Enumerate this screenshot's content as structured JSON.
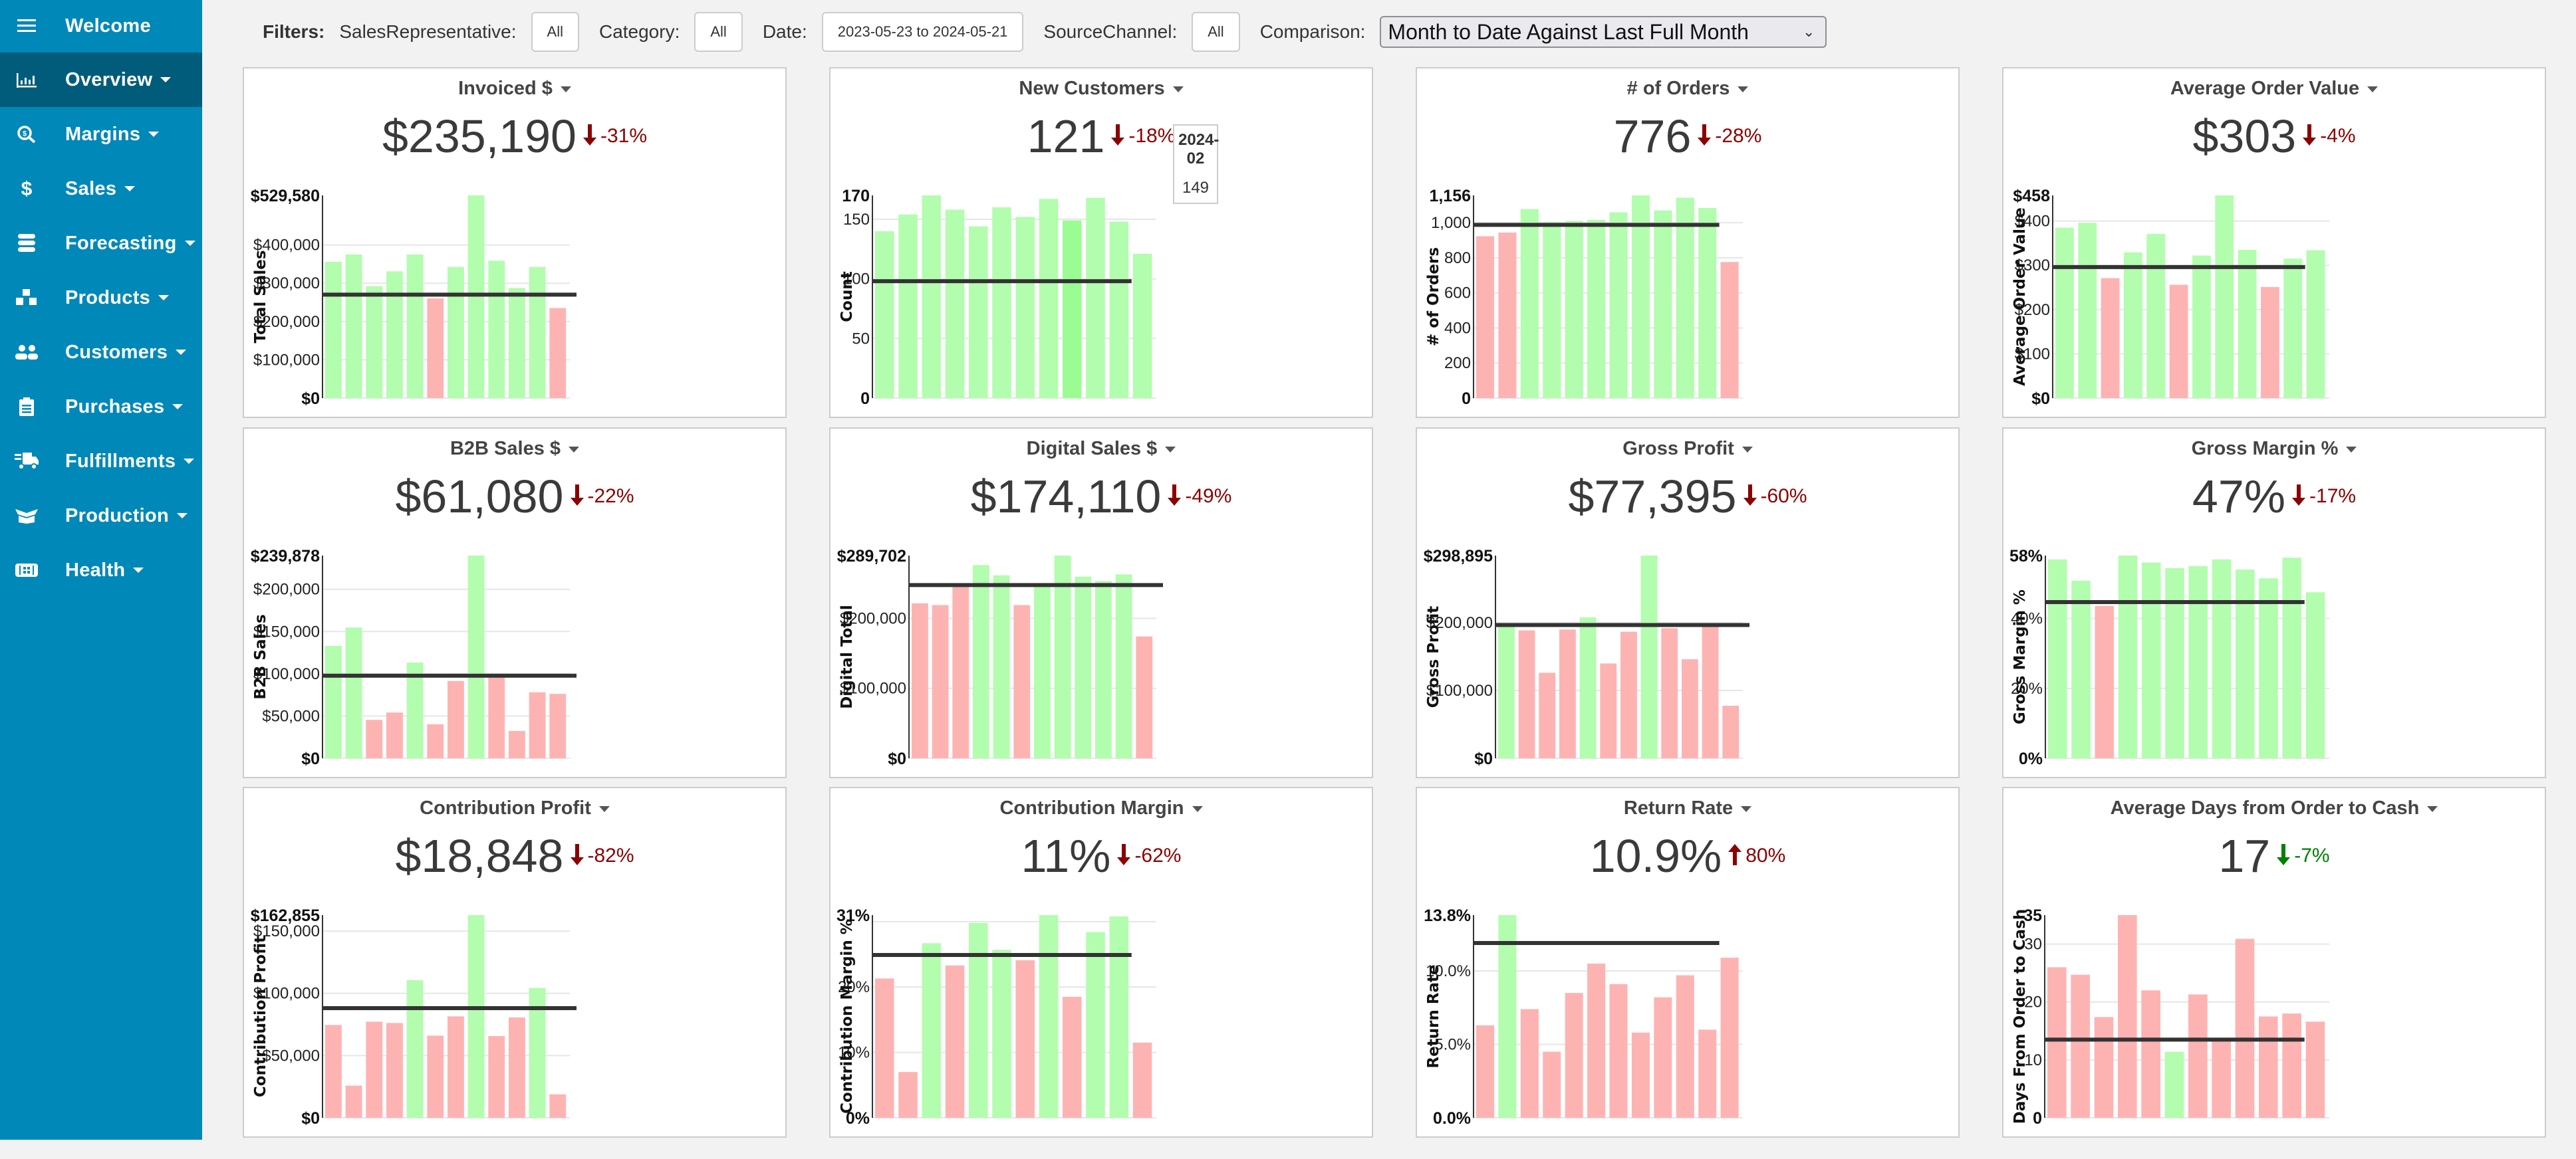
{
  "sidebar": {
    "items": [
      {
        "label": "Welcome",
        "icon": "menu-icon",
        "caret": false,
        "active": false
      },
      {
        "label": "Overview",
        "icon": "bar-chart-icon",
        "caret": true,
        "active": true
      },
      {
        "label": "Margins",
        "icon": "search-dollar-icon",
        "caret": true,
        "active": false
      },
      {
        "label": "Sales",
        "icon": "dollar-icon",
        "caret": true,
        "active": false
      },
      {
        "label": "Forecasting",
        "icon": "database-icon",
        "caret": true,
        "active": false
      },
      {
        "label": "Products",
        "icon": "boxes-icon",
        "caret": true,
        "active": false
      },
      {
        "label": "Customers",
        "icon": "users-icon",
        "caret": true,
        "active": false
      },
      {
        "label": "Purchases",
        "icon": "clipboard-icon",
        "caret": true,
        "active": false
      },
      {
        "label": "Fulfillments",
        "icon": "truck-icon",
        "caret": true,
        "active": false
      },
      {
        "label": "Production",
        "icon": "box-open-icon",
        "caret": true,
        "active": false
      },
      {
        "label": "Health",
        "icon": "health-icon",
        "caret": true,
        "active": false
      }
    ]
  },
  "filters": {
    "title": "Filters:",
    "sales_rep_label": "SalesRepresentative:",
    "sales_rep_value": "All",
    "category_label": "Category:",
    "category_value": "All",
    "date_label": "Date:",
    "date_value": "2023-05-23 to 2024-05-21",
    "source_label": "SourceChannel:",
    "source_value": "All",
    "comparison_label": "Comparison:",
    "comparison_value": "Month to Date Against Last Full Month"
  },
  "colors": {
    "sidebar_bg": "#0088b8",
    "sidebar_active": "#005c7a",
    "bar_good": "#b3fdae",
    "bar_bad": "#feb3b3",
    "bar_hover": "#9cfc94",
    "target_line": "#333333",
    "change_bad": "#8b0000",
    "change_good": "#008000"
  },
  "tooltip": {
    "card": 1,
    "bar_index": 8,
    "title": "2024-02",
    "value": "149"
  },
  "chart_data": [
    {
      "type": "bar",
      "title": "Invoiced $",
      "kpi": "$235,190",
      "change": "-31%",
      "direction": "down",
      "change_status": "bad",
      "ylabel": "Total Sales",
      "ylim": [
        0,
        529580
      ],
      "ymax_label": "$529,580",
      "ticks": [
        {
          "v": 100000,
          "l": "$100,000"
        },
        {
          "v": 200000,
          "l": "$200,000"
        },
        {
          "v": 300000,
          "l": "$300,000"
        },
        {
          "v": 400000,
          "l": "$400,000"
        }
      ],
      "zero_label": "$0",
      "values": [
        355950,
        375050,
        292290,
        331060,
        375050,
        260450,
        342630,
        529580,
        358840,
        287650,
        342630,
        235190
      ],
      "status": [
        "g",
        "g",
        "g",
        "g",
        "g",
        "r",
        "g",
        "g",
        "g",
        "g",
        "g",
        "r"
      ],
      "target": 270290,
      "target_full": true
    },
    {
      "type": "bar",
      "title": "New Customers",
      "kpi": "121",
      "change": "-18%",
      "direction": "down",
      "change_status": "bad",
      "ylabel": "Count",
      "ylim": [
        0,
        170
      ],
      "ymax_label": "170",
      "ticks": [
        {
          "v": 50,
          "l": "50"
        },
        {
          "v": 100,
          "l": "100"
        },
        {
          "v": 150,
          "l": "150"
        }
      ],
      "zero_label": "0",
      "values": [
        140,
        154,
        170,
        158,
        144,
        160,
        152,
        167,
        149,
        168,
        148,
        121
      ],
      "status": [
        "g",
        "g",
        "g",
        "g",
        "g",
        "g",
        "g",
        "g",
        "h",
        "g",
        "g",
        "g"
      ],
      "target": 98,
      "target_full": false
    },
    {
      "type": "bar",
      "title": "# of Orders",
      "kpi": "776",
      "change": "-28%",
      "direction": "down",
      "change_status": "bad",
      "ylabel": "# of Orders",
      "ylim": [
        0,
        1156
      ],
      "ymax_label": "1,156",
      "ticks": [
        {
          "v": 200,
          "l": "200"
        },
        {
          "v": 400,
          "l": "400"
        },
        {
          "v": 600,
          "l": "600"
        },
        {
          "v": 800,
          "l": "800"
        },
        {
          "v": 1000,
          "l": "1,000"
        }
      ],
      "zero_label": "0",
      "values": [
        923,
        944,
        1078,
        1005,
        1010,
        1016,
        1059,
        1156,
        1070,
        1143,
        1084,
        776
      ],
      "status": [
        "r",
        "r",
        "g",
        "g",
        "g",
        "g",
        "g",
        "g",
        "g",
        "g",
        "g",
        "r"
      ],
      "target": 988,
      "target_full": false
    },
    {
      "type": "bar",
      "title": "Average Order Value",
      "kpi": "$303",
      "change": "-4%",
      "direction": "down",
      "change_status": "bad",
      "ylabel": "Average Order Value",
      "ylim": [
        0,
        458
      ],
      "ymax_label": "$458",
      "ticks": [
        {
          "v": 100,
          "l": "$100"
        },
        {
          "v": 200,
          "l": "$200"
        },
        {
          "v": 300,
          "l": "$300"
        },
        {
          "v": 400,
          "l": "$400"
        }
      ],
      "zero_label": "$0",
      "values": [
        385,
        396,
        271,
        329,
        371,
        256,
        322,
        458,
        335,
        251,
        315,
        334
      ],
      "status": [
        "g",
        "g",
        "r",
        "g",
        "g",
        "r",
        "g",
        "g",
        "g",
        "r",
        "g",
        "g"
      ],
      "target": 296,
      "target_full": false
    },
    {
      "type": "bar",
      "title": "B2B Sales $",
      "kpi": "$61,080",
      "change": "-22%",
      "direction": "down",
      "change_status": "bad",
      "ylabel": "B2B Sales",
      "ylim": [
        0,
        239878
      ],
      "ymax_label": "$239,878",
      "ticks": [
        {
          "v": 50000,
          "l": "$50,000"
        },
        {
          "v": 100000,
          "l": "$100,000"
        },
        {
          "v": 150000,
          "l": "$150,000"
        },
        {
          "v": 200000,
          "l": "$200,000"
        }
      ],
      "zero_label": "$0",
      "values": [
        132940,
        154750,
        45450,
        54120,
        113240,
        40200,
        91430,
        239878,
        96690,
        32320,
        78030,
        76190
      ],
      "status": [
        "g",
        "g",
        "r",
        "r",
        "g",
        "r",
        "r",
        "g",
        "r",
        "r",
        "r",
        "r"
      ],
      "target": 97740,
      "target_full": true
    },
    {
      "type": "bar",
      "title": "Digital Sales $",
      "kpi": "$174,110",
      "change": "-49%",
      "direction": "down",
      "change_status": "bad",
      "ylabel": "Digital Total",
      "ylim": [
        0,
        289702
      ],
      "ymax_label": "$289,702",
      "ticks": [
        {
          "v": 100000,
          "l": "$100,000"
        },
        {
          "v": 200000,
          "l": "$200,000"
        }
      ],
      "zero_label": "$0",
      "values": [
        221480,
        218950,
        247500,
        276060,
        261460,
        218950,
        246870,
        289702,
        259560,
        253220,
        262740,
        174110
      ],
      "status": [
        "r",
        "r",
        "r",
        "g",
        "g",
        "r",
        "g",
        "g",
        "g",
        "g",
        "g",
        "r"
      ],
      "target": 247500,
      "target_full": true
    },
    {
      "type": "bar",
      "title": "Gross Profit",
      "kpi": "$77,395",
      "change": "-60%",
      "direction": "down",
      "change_status": "bad",
      "ylabel": "Gross Profit",
      "ylim": [
        0,
        298895
      ],
      "ymax_label": "$298,895",
      "ticks": [
        {
          "v": 100000,
          "l": "$100,000"
        },
        {
          "v": 200000,
          "l": "$200,000"
        }
      ],
      "zero_label": "$0",
      "values": [
        199700,
        188570,
        126040,
        189880,
        207880,
        139790,
        186610,
        298895,
        191840,
        146010,
        194790,
        77395
      ],
      "status": [
        "g",
        "r",
        "r",
        "r",
        "g",
        "r",
        "r",
        "g",
        "r",
        "r",
        "r",
        "r"
      ],
      "target": 196430,
      "target_full": true
    },
    {
      "type": "bar",
      "title": "Gross Margin %",
      "kpi": "47%",
      "change": "-17%",
      "direction": "down",
      "change_status": "bad",
      "ylabel": "Gross Margin %",
      "ylim": [
        0,
        58
      ],
      "ymax_label": "58%",
      "ticks": [
        {
          "v": 20,
          "l": "20%"
        },
        {
          "v": 40,
          "l": "40%"
        }
      ],
      "zero_label": "0%",
      "values": [
        56.9,
        50.8,
        43.6,
        58,
        56.0,
        54.4,
        55.0,
        56.9,
        54.0,
        51.5,
        57.4,
        47.5
      ],
      "status": [
        "g",
        "g",
        "r",
        "g",
        "g",
        "g",
        "g",
        "g",
        "g",
        "g",
        "g",
        "g"
      ],
      "target": 44.7,
      "target_full": false
    },
    {
      "type": "bar",
      "title": "Contribution Profit",
      "kpi": "$18,848",
      "change": "-82%",
      "direction": "down",
      "change_status": "bad",
      "ylabel": "Contribution Profit",
      "ylim": [
        0,
        162855
      ],
      "ymax_label": "$162,855",
      "ticks": [
        {
          "v": 50000,
          "l": "$50,000"
        },
        {
          "v": 100000,
          "l": "$100,000"
        },
        {
          "v": 150000,
          "l": "$150,000"
        }
      ],
      "zero_label": "$0",
      "values": [
        74560,
        25860,
        77230,
        76160,
        110590,
        66000,
        81520,
        162855,
        65640,
        80630,
        104350,
        18848
      ],
      "status": [
        "r",
        "r",
        "r",
        "r",
        "g",
        "r",
        "r",
        "g",
        "r",
        "r",
        "g",
        "r"
      ],
      "target": 88120,
      "target_full": true
    },
    {
      "type": "bar",
      "title": "Contribution Margin",
      "kpi": "11%",
      "change": "-62%",
      "direction": "down",
      "change_status": "bad",
      "ylabel": "Contribution Margin %",
      "ylim": [
        0,
        31
      ],
      "ymax_label": "31%",
      "ticks": [
        {
          "v": 10,
          "l": "10%"
        },
        {
          "v": 20,
          "l": "20%"
        },
        {
          "v": 30,
          "l": ""
        }
      ],
      "zero_label": "0%",
      "values": [
        21.3,
        7.0,
        26.7,
        23.3,
        29.8,
        25.7,
        24.1,
        31.0,
        18.5,
        28.4,
        30.8,
        11.5
      ],
      "status": [
        "r",
        "r",
        "g",
        "r",
        "g",
        "g",
        "r",
        "g",
        "r",
        "g",
        "g",
        "r"
      ],
      "target": 24.9,
      "target_full": false
    },
    {
      "type": "bar",
      "title": "Return Rate",
      "kpi": "10.9%",
      "change": "80%",
      "direction": "up",
      "change_status": "bad",
      "ylabel": "Return Rate",
      "ylim": [
        0,
        13.8
      ],
      "ymax_label": "13.8%",
      "ticks": [
        {
          "v": 5,
          "l": "5.0%"
        },
        {
          "v": 10,
          "l": "10.0%"
        }
      ],
      "zero_label": "0.0%",
      "values": [
        6.3,
        13.8,
        7.4,
        4.5,
        8.5,
        10.5,
        9.1,
        5.8,
        8.2,
        9.7,
        6.0,
        10.9
      ],
      "status": [
        "r",
        "g",
        "r",
        "r",
        "r",
        "r",
        "r",
        "r",
        "r",
        "r",
        "r",
        "r"
      ],
      "target": 11.9,
      "target_full": false
    },
    {
      "type": "bar",
      "title": "Average Days from Order to Cash",
      "kpi": "17",
      "change": "-7%",
      "direction": "down",
      "change_status": "good",
      "ylabel": "Days From Order to Cash",
      "ylim": [
        0,
        35
      ],
      "ymax_label": "35",
      "ticks": [
        {
          "v": 10,
          "l": "10"
        },
        {
          "v": 20,
          "l": "20"
        },
        {
          "v": 30,
          "l": "30"
        }
      ],
      "zero_label": "0",
      "values": [
        26.0,
        24.7,
        17.4,
        35,
        22.0,
        11.4,
        21.3,
        13.3,
        30.9,
        17.5,
        18.0,
        16.6
      ],
      "status": [
        "r",
        "r",
        "r",
        "r",
        "r",
        "g",
        "r",
        "r",
        "r",
        "r",
        "r",
        "r"
      ],
      "target": 13.5,
      "target_full": false
    }
  ]
}
